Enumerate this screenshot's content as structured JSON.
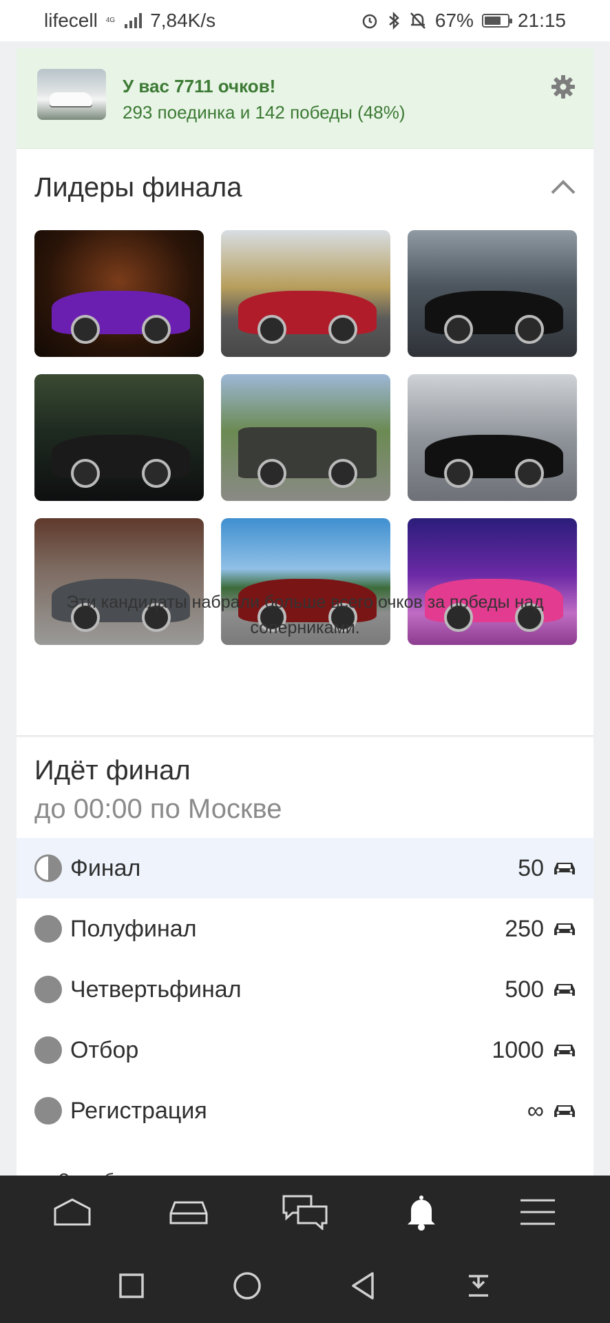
{
  "status_bar": {
    "carrier": "lifecell",
    "network": "4G",
    "speed": "7,84K/s",
    "battery": "67%",
    "battery_level": 0.67,
    "time": "21:15"
  },
  "banner": {
    "title": "У вас 7711 очков!",
    "subtitle": "293 поединка и 142 победы (48%)",
    "settings_icon": "gear-icon",
    "color": "#3c7a34"
  },
  "leaders": {
    "title": "Лидеры финала",
    "collapse_icon": "chevron-up-icon",
    "caption": "Эти кандидаты набрали больше всего очков за победы над соперниками."
  },
  "final": {
    "title": "Идёт финал",
    "subtitle": "до 00:00 по Москве",
    "stages": [
      {
        "label": "Финал",
        "count": "50",
        "active": true
      },
      {
        "label": "Полуфинал",
        "count": "250"
      },
      {
        "label": "Четвертьфинал",
        "count": "500"
      },
      {
        "label": "Отбор",
        "count": "1000"
      },
      {
        "label": "Регистрация",
        "count": "∞"
      }
    ],
    "footnote": "За победу в каждом поединке начисляются очки в размере"
  },
  "bottom_nav": [
    "home-icon",
    "car-icon",
    "chat-icon",
    "bell-icon",
    "menu-icon"
  ],
  "system_nav": [
    "square-icon",
    "circle-icon",
    "back-icon",
    "download-icon"
  ]
}
